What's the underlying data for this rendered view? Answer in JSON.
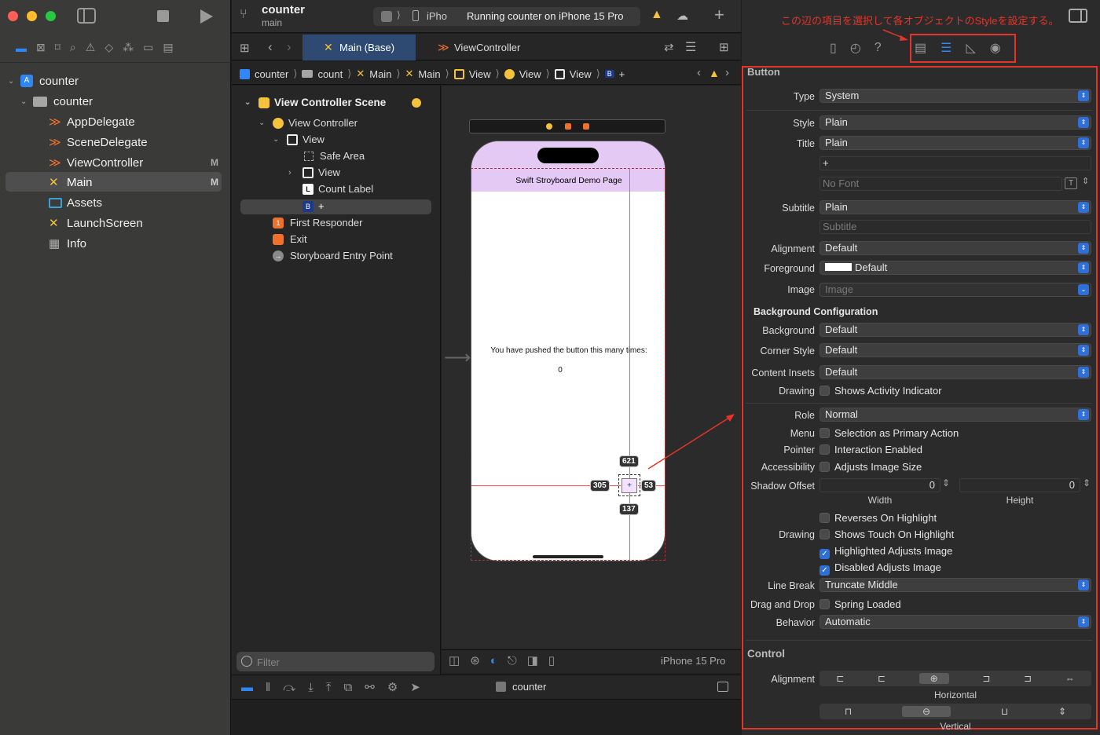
{
  "window": {
    "project_name": "counter",
    "branch": "main",
    "scheme_device": "iPho",
    "status": "Running counter on iPhone 15 Pro"
  },
  "sidebar": {
    "tree": [
      {
        "label": "counter",
        "icon": "app-project-icon",
        "level": 0
      },
      {
        "label": "counter",
        "icon": "folder-icon",
        "level": 1
      },
      {
        "label": "AppDelegate",
        "icon": "swift-file-icon",
        "level": 2,
        "badge": ""
      },
      {
        "label": "SceneDelegate",
        "icon": "swift-file-icon",
        "level": 2,
        "badge": ""
      },
      {
        "label": "ViewController",
        "icon": "swift-file-icon",
        "level": 2,
        "badge": "M"
      },
      {
        "label": "Main",
        "icon": "storyboard-icon",
        "level": 2,
        "badge": "M"
      },
      {
        "label": "Assets",
        "icon": "assets-icon",
        "level": 2,
        "badge": ""
      },
      {
        "label": "LaunchScreen",
        "icon": "storyboard-icon",
        "level": 2,
        "badge": ""
      },
      {
        "label": "Info",
        "icon": "plist-icon",
        "level": 2,
        "badge": ""
      }
    ]
  },
  "editor": {
    "tabs": [
      "Main (Base)",
      "ViewController"
    ],
    "breadcrumb": [
      "counter",
      "count",
      "Main",
      "Main",
      "View",
      "View",
      "View",
      "+"
    ],
    "breadcrumb_last_icon": "B",
    "outline": {
      "scene": "View Controller Scene",
      "view_controller": "View Controller",
      "view": "View",
      "safe_area": "Safe Area",
      "subview": "View",
      "count_label": "Count Label",
      "count_label_icon": "L",
      "button": "+",
      "button_icon": "B",
      "first_responder": "First Responder",
      "exit": "Exit",
      "entry_point": "Storyboard Entry Point"
    },
    "filter_placeholder": "Filter",
    "canvas": {
      "header_text": "Swift Stroyboard Demo Page",
      "body_text": "You have pushed the button this many times:",
      "count_value": "0",
      "button_text": "+",
      "constraints": {
        "top": "621",
        "left": "305",
        "right": "53",
        "bottom": "137"
      },
      "device_label": "iPhone 15 Pro"
    },
    "debug_target": "counter"
  },
  "inspector": {
    "annotation": "この辺の項目を選択して各オブジェクトのStyleを設定する。",
    "section_button": "Button",
    "type": {
      "label": "Type",
      "value": "System"
    },
    "style": {
      "label": "Style",
      "value": "Plain"
    },
    "title": {
      "label": "Title",
      "value": "Plain",
      "text": "+",
      "font_placeholder": "No Font"
    },
    "subtitle": {
      "label": "Subtitle",
      "value": "Plain",
      "placeholder": "Subtitle"
    },
    "alignment": {
      "label": "Alignment",
      "value": "Default"
    },
    "foreground": {
      "label": "Foreground",
      "value": "Default"
    },
    "image": {
      "label": "Image",
      "placeholder": "Image"
    },
    "bg_config_title": "Background Configuration",
    "background": {
      "label": "Background",
      "value": "Default"
    },
    "corner_style": {
      "label": "Corner Style",
      "value": "Default"
    },
    "content_insets": {
      "label": "Content Insets",
      "value": "Default"
    },
    "drawing1": {
      "label": "Drawing",
      "option": "Shows Activity Indicator"
    },
    "role": {
      "label": "Role",
      "value": "Normal"
    },
    "menu": {
      "label": "Menu",
      "option": "Selection as Primary Action"
    },
    "pointer": {
      "label": "Pointer",
      "option": "Interaction Enabled"
    },
    "accessibility": {
      "label": "Accessibility",
      "option": "Adjusts Image Size"
    },
    "shadow_offset": {
      "label": "Shadow Offset",
      "width_value": "0",
      "height_value": "0",
      "width_label": "Width",
      "height_label": "Height"
    },
    "drawing2": {
      "label": "Drawing",
      "options": [
        {
          "text": "Reverses On Highlight",
          "checked": false
        },
        {
          "text": "Shows Touch On Highlight",
          "checked": false
        },
        {
          "text": "Highlighted Adjusts Image",
          "checked": true
        },
        {
          "text": "Disabled Adjusts Image",
          "checked": true
        }
      ]
    },
    "line_break": {
      "label": "Line Break",
      "value": "Truncate Middle"
    },
    "drag_drop": {
      "label": "Drag and Drop",
      "option": "Spring Loaded"
    },
    "behavior": {
      "label": "Behavior",
      "value": "Automatic"
    },
    "section_control": "Control",
    "control_alignment_label": "Alignment",
    "horizontal_label": "Horizontal",
    "vertical_label": "Vertical"
  },
  "colors": {
    "accent": "#2f6fd9",
    "annotation_red": "#e53528",
    "canvas_header": "#e5c9f5",
    "swift_orange": "#f0712c"
  }
}
